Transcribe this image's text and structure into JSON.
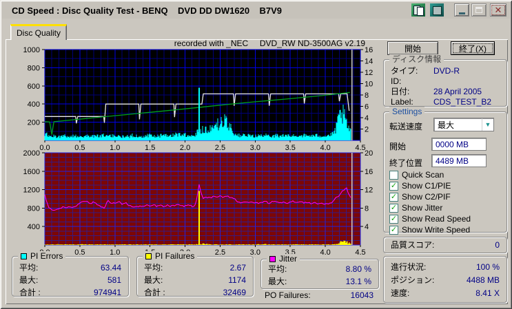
{
  "window": {
    "title": "CD Speed : Disc Quality Test - BENQ    DVD DD DW1620    B7V9"
  },
  "titlebar_buttons": {
    "minimize": "minimize",
    "maximize": "maximize",
    "close_glyph": "✕"
  },
  "tab": {
    "label": "Disc Quality"
  },
  "buttons": {
    "start": "開始",
    "exit": "終了(X)"
  },
  "disc_info": {
    "caption": "ディスク情報",
    "rows": [
      {
        "label": "タイプ:",
        "value": "DVD-R"
      },
      {
        "label": "ID:",
        "value": ""
      },
      {
        "label": "日付:",
        "value": "28 April 2005"
      },
      {
        "label": "Label:",
        "value": "CDS_TEST_B2"
      }
    ]
  },
  "settings": {
    "caption": "Settings",
    "speed_label": "転送速度",
    "speed_value": "最大",
    "start_label": "開始",
    "start_value": "0000 MB",
    "end_label": "終了位置",
    "end_value": "4489 MB",
    "checkboxes": [
      {
        "label": "Quick Scan",
        "checked": false
      },
      {
        "label": "Show C1/PIE",
        "checked": true
      },
      {
        "label": "Show C2/PIF",
        "checked": true
      },
      {
        "label": "Show Jitter",
        "checked": true
      },
      {
        "label": "Show Read Speed",
        "checked": true
      },
      {
        "label": "Show Write Speed",
        "checked": true
      }
    ]
  },
  "score": {
    "label": "品質スコア:",
    "value": "0"
  },
  "progress": {
    "rows": [
      {
        "label": "進行状況:",
        "value": "100 %"
      },
      {
        "label": "ポジション:",
        "value": "4488 MB"
      },
      {
        "label": "速度:",
        "value": "8.41 X"
      }
    ]
  },
  "stats": {
    "pi_errors": {
      "title": "PI Errors",
      "swatch": "#00ffff",
      "rows": [
        {
          "label": "平均:",
          "value": "63.44"
        },
        {
          "label": "最大:",
          "value": "581"
        },
        {
          "label": "合計 :",
          "value": "974941"
        }
      ]
    },
    "pi_failures": {
      "title": "PI Failures",
      "swatch": "#ffff00",
      "rows": [
        {
          "label": "平均:",
          "value": "2.67"
        },
        {
          "label": "最大:",
          "value": "1174"
        },
        {
          "label": "合計 :",
          "value": "32469"
        }
      ]
    },
    "jitter": {
      "title": "Jitter",
      "swatch": "#ff00ff",
      "rows": [
        {
          "label": "平均:",
          "value": "8.80 %"
        },
        {
          "label": "最大:",
          "value": "13.1 %"
        }
      ]
    },
    "po_failures": {
      "label": "PO Failures:",
      "value": "16043"
    }
  },
  "chart_data": [
    {
      "type": "line",
      "title": "PI Errors / Speed scan",
      "annotation": "recorded with _NEC     DVD_RW ND-3500AG v2.19",
      "x_range": [
        0,
        4.5
      ],
      "x_minor": 0.1,
      "x_ticks": [
        0,
        0.5,
        1,
        1.5,
        2,
        2.5,
        3,
        3.5,
        4,
        4.5
      ],
      "xlabel": "",
      "ylabel": "",
      "bg": "#000000",
      "grid_minor": "#000078",
      "grid_major": "#0000e8",
      "left_axis": {
        "range": [
          0,
          1000
        ],
        "minor": 100,
        "majors": [
          0,
          200,
          400,
          600,
          800,
          1000
        ],
        "labels": [
          200,
          400,
          600,
          800,
          1000
        ]
      },
      "right_axis": {
        "range": [
          0,
          16
        ],
        "labels": [
          2,
          4,
          6,
          8,
          10,
          12,
          14,
          16
        ]
      },
      "data_end": 4.37,
      "end_marker_x": 4.38,
      "end_marker_color": "#cccccc",
      "series": [
        {
          "name": "PI Errors",
          "type": "area-noise",
          "axis": "left",
          "color": "#00ffff",
          "step": 0.05,
          "noise": [
            0.5,
            1.25
          ],
          "values": [
            85,
            60,
            50,
            55,
            48,
            52,
            60,
            47,
            52,
            56,
            64,
            52,
            56,
            48,
            60,
            52,
            56,
            64,
            52,
            56,
            60,
            52,
            48,
            56,
            52,
            60,
            56,
            52,
            60,
            56,
            64,
            56,
            52,
            60,
            56,
            64,
            60,
            70,
            80,
            75,
            70,
            66,
            62,
            75,
            150,
            140,
            135,
            150,
            165,
            185,
            215,
            245,
            215,
            185,
            85,
            66,
            60,
            66,
            56,
            60,
            56,
            60,
            56,
            60,
            56,
            60,
            64,
            56,
            60,
            56,
            60,
            56,
            60,
            64,
            60,
            56,
            60,
            56,
            64,
            60,
            56,
            64,
            75,
            140,
            300,
            330,
            220,
            110
          ]
        },
        {
          "name": "Write Speed",
          "type": "line",
          "axis": "right",
          "color": "#e8e8e8",
          "points": [
            [
              0,
              4.2
            ],
            [
              0.44,
              4.2
            ],
            [
              0.45,
              3.0
            ],
            [
              0.47,
              4.2
            ],
            [
              0.84,
              4.2
            ],
            [
              0.85,
              3.1
            ],
            [
              0.87,
              6.4
            ],
            [
              1.34,
              6.4
            ],
            [
              1.35,
              3.7
            ],
            [
              1.37,
              6.4
            ],
            [
              1.84,
              6.4
            ],
            [
              1.85,
              4.1
            ],
            [
              1.87,
              6.4
            ],
            [
              2.24,
              6.4
            ],
            [
              2.26,
              8.2
            ],
            [
              2.69,
              8.2
            ],
            [
              2.7,
              6.1
            ],
            [
              2.72,
              8.2
            ],
            [
              3.19,
              8.2
            ],
            [
              3.2,
              6.1
            ],
            [
              3.22,
              8.2
            ],
            [
              3.69,
              8.2
            ],
            [
              3.7,
              6.5
            ],
            [
              3.72,
              8.2
            ],
            [
              4.19,
              8.2
            ],
            [
              4.2,
              6.9
            ],
            [
              4.22,
              8.2
            ],
            [
              4.31,
              8.2
            ],
            [
              4.34,
              5.2
            ]
          ]
        },
        {
          "name": "Read Speed",
          "type": "line",
          "axis": "right",
          "color": "#00a020",
          "points": [
            [
              0,
              3.3
            ],
            [
              0.07,
              3.25
            ],
            [
              0.1,
              1.0
            ],
            [
              0.13,
              3.3
            ],
            [
              0.5,
              3.75
            ],
            [
              1.0,
              4.35
            ],
            [
              1.5,
              4.95
            ],
            [
              2.0,
              5.55
            ],
            [
              2.5,
              6.2
            ],
            [
              3.0,
              6.8
            ],
            [
              3.5,
              7.35
            ],
            [
              4.0,
              7.95
            ],
            [
              4.35,
              8.45
            ]
          ]
        },
        {
          "name": "PI Errors max spike",
          "type": "spikes",
          "axis": "left",
          "color": "#00ffff",
          "points": [
            [
              2.2,
              581
            ]
          ]
        }
      ]
    },
    {
      "type": "line",
      "title": "PI Failures / Jitter scan",
      "annotation": "",
      "x_range": [
        0,
        4.5
      ],
      "x_minor": 0.1,
      "x_ticks": [
        0,
        0.5,
        1,
        1.5,
        2,
        2.5,
        3,
        3.5,
        4,
        4.5
      ],
      "xlabel": "",
      "ylabel": "",
      "bg": "#7c0606",
      "grid_minor": "#351a86",
      "grid_major": "#2323e0",
      "left_axis": {
        "range": [
          0,
          2000
        ],
        "minor": 100,
        "majors": [
          0,
          400,
          800,
          1200,
          1600,
          2000
        ],
        "labels": [
          400,
          800,
          1200,
          1600,
          2000
        ]
      },
      "right_axis": {
        "range": [
          0,
          20
        ],
        "labels": [
          4,
          8,
          12,
          16,
          20
        ]
      },
      "data_end": 4.37,
      "end_marker_x": 4.38,
      "end_marker_color": "#cccccc",
      "series": [
        {
          "name": "PI Failures",
          "type": "area-noise",
          "axis": "left",
          "color": "#ffff00",
          "step": 0.05,
          "noise": [
            0.4,
            1.4
          ],
          "values": [
            12,
            10,
            14,
            11,
            15,
            12,
            10,
            13,
            11,
            14,
            12,
            15,
            10,
            13,
            12,
            11,
            14,
            10,
            12,
            15,
            11,
            13,
            10,
            14,
            12,
            11,
            15,
            10,
            13,
            12,
            11,
            14,
            12,
            10,
            15,
            11,
            13,
            12,
            10,
            14,
            11,
            12,
            15,
            13,
            18,
            28,
            22,
            16,
            13,
            12,
            14,
            11,
            13,
            15,
            12,
            10,
            14,
            12,
            11,
            13,
            10,
            14,
            12,
            15,
            11,
            13,
            12,
            10,
            14,
            11,
            13,
            12,
            15,
            10,
            13,
            11,
            14,
            12,
            10,
            13,
            11,
            14,
            12,
            16,
            55,
            75,
            65,
            45
          ]
        },
        {
          "name": "PI Failures max spike",
          "type": "spikes",
          "axis": "left",
          "color": "#ffff00",
          "points": [
            [
              2.2,
              1174
            ]
          ]
        },
        {
          "name": "Jitter",
          "type": "line-noise",
          "axis": "right",
          "color": "#ff00ff",
          "step": 0.05,
          "noise": 0.3,
          "values": [
            11.0,
            8.1,
            7.7,
            7.6,
            7.9,
            8.2,
            8.0,
            8.4,
            8.1,
            8.5,
            9.2,
            9.6,
            9.4,
            9.0,
            9.3,
            8.8,
            8.3,
            8.1,
            9.7,
            8.9,
            9.1,
            9.4,
            8.9,
            9.2,
            8.6,
            8.3,
            8.2,
            8.5,
            8.3,
            8.6,
            8.4,
            8.7,
            8.4,
            8.6,
            8.3,
            8.6,
            8.4,
            8.6,
            8.7,
            8.4,
            8.5,
            8.7,
            8.4,
            8.6,
            13.1,
            10.1,
            10.4,
            10.2,
            10.5,
            10.3,
            10.6,
            10.4,
            10.7,
            10.3,
            10.1,
            9.4,
            9.2,
            9.4,
            9.1,
            9.3,
            9.2,
            9.0,
            9.3,
            9.5,
            9.0,
            9.6,
            9.3,
            9.1,
            9.4,
            9.1,
            9.3,
            9.5,
            9.2,
            9.4,
            9.1,
            9.3,
            9.0,
            9.2,
            8.9,
            9.1,
            8.8,
            9.0,
            9.3,
            10.3,
            10.7,
            11.8,
            12.4,
            10.4
          ]
        }
      ]
    }
  ]
}
